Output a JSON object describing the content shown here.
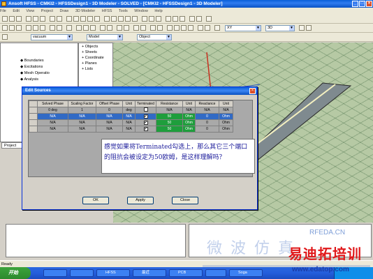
{
  "window": {
    "title": "Ansoft HFSS - CMKI2 - HFSSDesign1 - 3D Modeler - SOLVED - [CMKI2 - HFSSDesign1 - 3D Modeler]"
  },
  "menu": [
    "File",
    "Edit",
    "View",
    "Project",
    "Draw",
    "3D Modeler",
    "HFSS",
    "Tools",
    "Window",
    "Help"
  ],
  "toolbar": {
    "material_combo": "vacuum",
    "model_combo": "Model",
    "objects_combo": "Object",
    "xy_combo": "XY",
    "plane_combo": "3D"
  },
  "project_tree": {
    "items": [
      "Boundaries",
      "Excitations",
      "Mesh Operatio",
      "Analysis"
    ],
    "tab": "Project"
  },
  "object_tree": {
    "items": [
      "Objects",
      "Sheets",
      "Coordinate",
      "Planes",
      "Lists"
    ]
  },
  "dialog": {
    "title": "Edit Sources",
    "columns": [
      "",
      "Solved Phase",
      "Scaling Factor",
      "Offset Phase",
      "Unit",
      "Terminated",
      "Resistance",
      "Unit",
      "Reactance",
      "Unit"
    ],
    "rows": [
      {
        "solved": "0 deg",
        "scale": "1",
        "offset": "0",
        "unit": "deg",
        "terminated": false,
        "res": "N/A",
        "runit": "N/A",
        "react": "N/A",
        "xunit": "N/A",
        "selected": false
      },
      {
        "solved": "N/A",
        "scale": "N/A",
        "offset": "N/A",
        "unit": "N/A",
        "terminated": true,
        "res": "50",
        "runit": "Ohm",
        "react": "0",
        "xunit": "Ohm",
        "selected": true
      },
      {
        "solved": "N/A",
        "scale": "N/A",
        "offset": "N/A",
        "unit": "N/A",
        "terminated": true,
        "res": "50",
        "runit": "Ohm",
        "react": "0",
        "xunit": "Ohm",
        "selected": false
      },
      {
        "solved": "N/A",
        "scale": "N/A",
        "offset": "N/A",
        "unit": "N/A",
        "terminated": true,
        "res": "50",
        "runit": "Ohm",
        "react": "0",
        "xunit": "Ohm",
        "selected": false
      }
    ],
    "buttons": {
      "ok": "OK",
      "apply": "Apply",
      "close": "Close"
    }
  },
  "note": {
    "text": "感觉如果将Terminated勾选上，那么其它三个端口的阻抗会被设定为50欧姆，是这样理解吗？"
  },
  "status": {
    "text": "Ready"
  },
  "taskbar": {
    "start": "开始",
    "tasks": [
      "",
      "",
      "HFSS",
      "最近",
      "PCB",
      "",
      "Soga"
    ]
  },
  "watermarks": {
    "site1": "RFEDA.CN",
    "cn_bg": "微波仿真",
    "brand": "易迪拓培训",
    "url": "www.edatop.com"
  },
  "colors": {
    "accent": "#0a5fd8",
    "selection": "#316ac5",
    "highlight": "#1e9e3c",
    "note_text": "#1a1a9a",
    "brand_red": "#e0181a"
  }
}
